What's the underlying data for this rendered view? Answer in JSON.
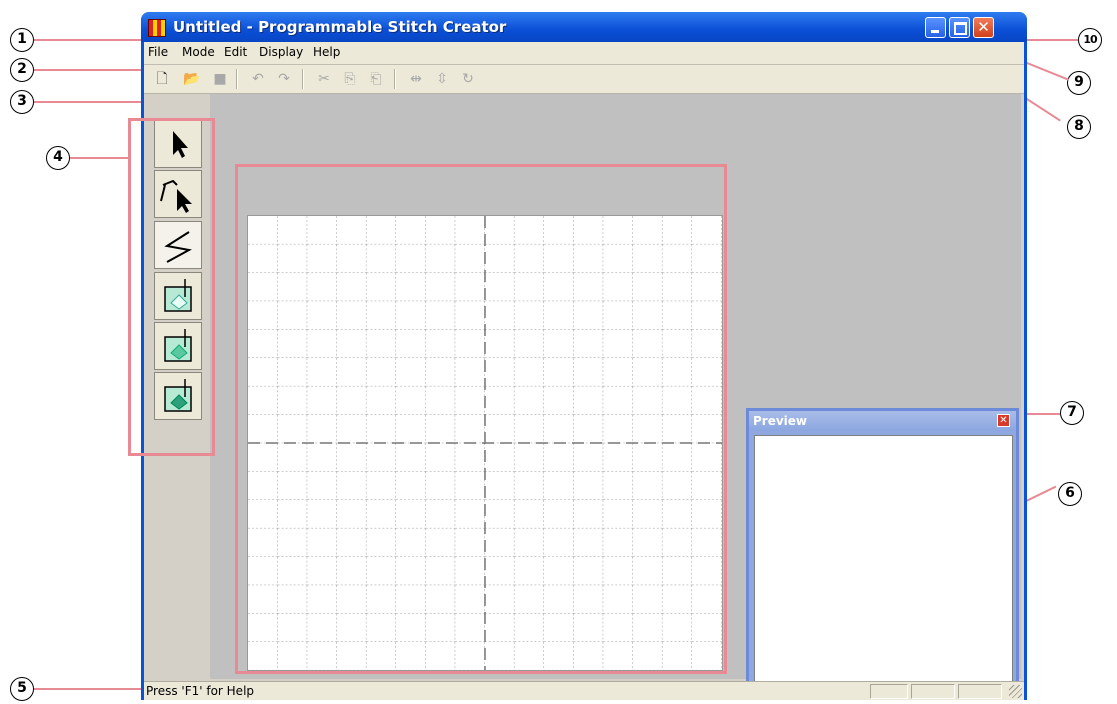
{
  "window": {
    "title": "Untitled - Programmable Stitch Creator",
    "buttons": {
      "minimize": "minimize",
      "maximize": "maximize",
      "close": "✕"
    }
  },
  "menu": {
    "items": [
      "File",
      "Mode",
      "Edit",
      "Display",
      "Help"
    ]
  },
  "toolbar": {
    "icons": [
      "new-icon",
      "open-icon",
      "save-icon",
      "undo-icon",
      "redo-icon",
      "cut-icon",
      "copy-icon",
      "paste-icon",
      "flip-horizontal-icon",
      "flip-vertical-icon",
      "rotate-icon"
    ],
    "glyphs": {
      "new": "🗋",
      "open": "📂",
      "save": "■",
      "undo": "↶",
      "redo": "↷",
      "cut": "✂",
      "copy": "⎘",
      "paste": "⎗",
      "flip_h": "⇹",
      "flip_v": "⇳",
      "rotate": "↻"
    }
  },
  "tools": [
    "select-tool",
    "point-edit-tool",
    "stitch-line-tool",
    "fill-tool-1",
    "fill-tool-2",
    "fill-tool-3"
  ],
  "preview": {
    "title": "Preview",
    "close": "✕"
  },
  "status": {
    "help_text": "Press 'F1' for Help"
  },
  "callouts": {
    "c1": "1",
    "c2": "2",
    "c3": "3",
    "c4": "4",
    "c5": "5",
    "c6": "6",
    "c7": "7",
    "c8": "8",
    "c9": "9",
    "c10": "10"
  },
  "colors": {
    "titlebar": "#0a4fd6",
    "highlight_frame": "#e88a93",
    "preview_frame": "#6c8ad8"
  }
}
